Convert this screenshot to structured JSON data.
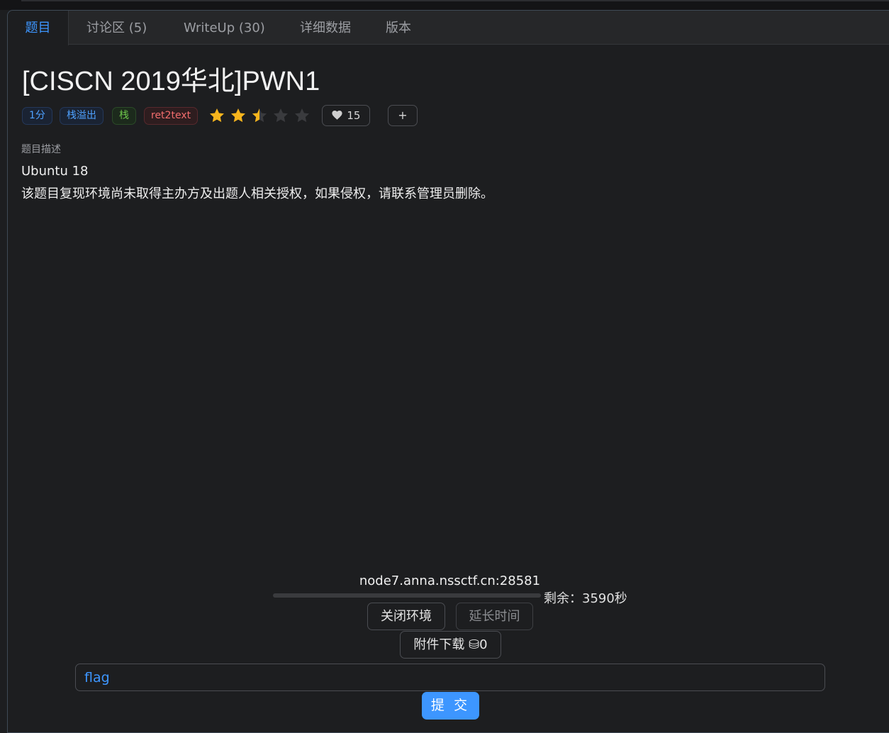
{
  "tabs": [
    {
      "label": "题目"
    },
    {
      "label": "讨论区 (5)"
    },
    {
      "label": "WriteUp (30)"
    },
    {
      "label": "详细数据"
    },
    {
      "label": "版本"
    }
  ],
  "title": "[CISCN 2019华北]PWN1",
  "tags": [
    {
      "label": "1分",
      "color": "#4ea1ff"
    },
    {
      "label": "栈溢出",
      "color": "#4ea1ff"
    },
    {
      "label": "栈",
      "color": "#6cc44a"
    },
    {
      "label": "ret2text",
      "color": "#f26d6d"
    }
  ],
  "rating": {
    "value": 2.5,
    "max": 5,
    "color": "#f7b51d"
  },
  "likes": {
    "icon": "heart-icon",
    "count": "15"
  },
  "add_button": {
    "label": "+"
  },
  "description": {
    "label": "题目描述",
    "lines": [
      "Ubuntu 18",
      "该题目复现环境尚未取得主办方及出题人相关授权，如果侵权，请联系管理员删除。"
    ]
  },
  "environment": {
    "host": "node7.anna.nssctf.cn:28581",
    "remaining": "剩余：3590秒",
    "close_label": "关闭环境",
    "extend_label": "延长时间",
    "download_label": "附件下载 ⛁0"
  },
  "flag": {
    "placeholder": "flag",
    "value": ""
  },
  "submit": {
    "label": "提 交"
  },
  "accent_color": "#3d96ff"
}
